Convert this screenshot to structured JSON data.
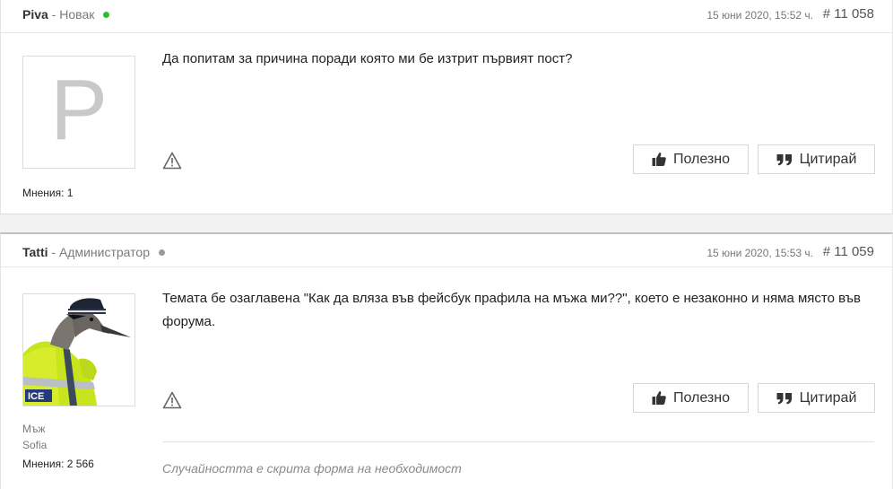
{
  "colors": {
    "online": "#2bbf2b",
    "offline": "#9a9a9a",
    "separator": "#b9c3cc"
  },
  "posts": [
    {
      "author": "Piva",
      "separator": "-",
      "role": "Новак",
      "status": "online",
      "date": "15 юни 2020, 15:52 ч.",
      "number": "# 11 058",
      "avatar_letter": "P",
      "message": "Да попитам за причина поради която ми бе изтрит първият пост?",
      "user_info": {
        "count_label": "Мнения: 1"
      },
      "actions": {
        "like": "Полезно",
        "quote": "Цитирай"
      },
      "icons": {
        "report": "warning-triangle-icon",
        "like": "thumbs-up-icon",
        "quote": "quote-icon"
      }
    },
    {
      "author": "Tatti",
      "separator": "-",
      "role": "Администратор",
      "status": "offline",
      "date": "15 юни 2020, 15:53 ч.",
      "number": "# 11 059",
      "avatar_image": "police-bird-avatar",
      "avatar_badge_text": "ICE",
      "message": "Темата бе озаглавена \"Как да вляза във фейсбук прафила на мъжа ми??\", което е незаконно и няма място във форума.",
      "user_info": {
        "gender": "Мъж",
        "location": "Sofia",
        "count_label": "Мнения: 2 566"
      },
      "actions": {
        "like": "Полезно",
        "quote": "Цитирай"
      },
      "signature": "Случайността е скрита форма на необходимост",
      "icons": {
        "report": "warning-triangle-icon",
        "like": "thumbs-up-icon",
        "quote": "quote-icon"
      }
    }
  ]
}
